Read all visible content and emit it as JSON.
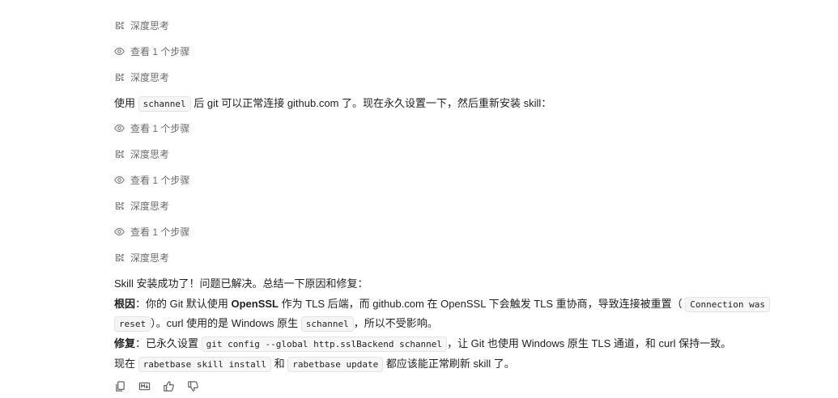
{
  "steps": [
    {
      "type": "think",
      "label": "深度思考"
    },
    {
      "type": "view",
      "label": "查看 1 个步骤"
    },
    {
      "type": "think",
      "label": "深度思考"
    },
    {
      "type": "view",
      "label": "查看 1 个步骤"
    },
    {
      "type": "think",
      "label": "深度思考"
    },
    {
      "type": "view",
      "label": "查看 1 个步骤"
    },
    {
      "type": "think",
      "label": "深度思考"
    },
    {
      "type": "view",
      "label": "查看 1 个步骤"
    },
    {
      "type": "think",
      "label": "深度思考"
    }
  ],
  "msg1": {
    "pre": "使用",
    "code": "schannel",
    "post": "后 git 可以正常连接 github.com 了。现在永久设置一下，然后重新安装 skill："
  },
  "summary": {
    "title": "Skill 安装成功了！问题已解决。总结一下原因和修复：",
    "cause_label": "根因",
    "cause_pre": "：你的 Git 默认使用 ",
    "cause_bold": "OpenSSL",
    "cause_mid": " 作为 TLS 后端，而 github.com 在 OpenSSL 下会触发 TLS 重协商，导致连接被重置（",
    "cause_code1": "Connection was",
    "cause_code2": "reset",
    "cause_post": "）。curl 使用的是 Windows 原生",
    "cause_code3": "schannel",
    "cause_end": "，所以不受影响。",
    "fix_label": "修复",
    "fix_pre": "：已永久设置",
    "fix_code": "git config --global http.sslBackend schannel",
    "fix_post": "，让 Git 也使用 Windows 原生 TLS 通道，和 curl 保持一致。",
    "now_pre": "现在",
    "now_code1": "rabetbase skill install",
    "now_mid": "和",
    "now_code2": "rabetbase update",
    "now_post": "都应该能正常刷新 skill 了。"
  },
  "actions": [
    "copy-icon",
    "markdown-icon",
    "thumbs-up-icon",
    "thumbs-down-icon"
  ]
}
